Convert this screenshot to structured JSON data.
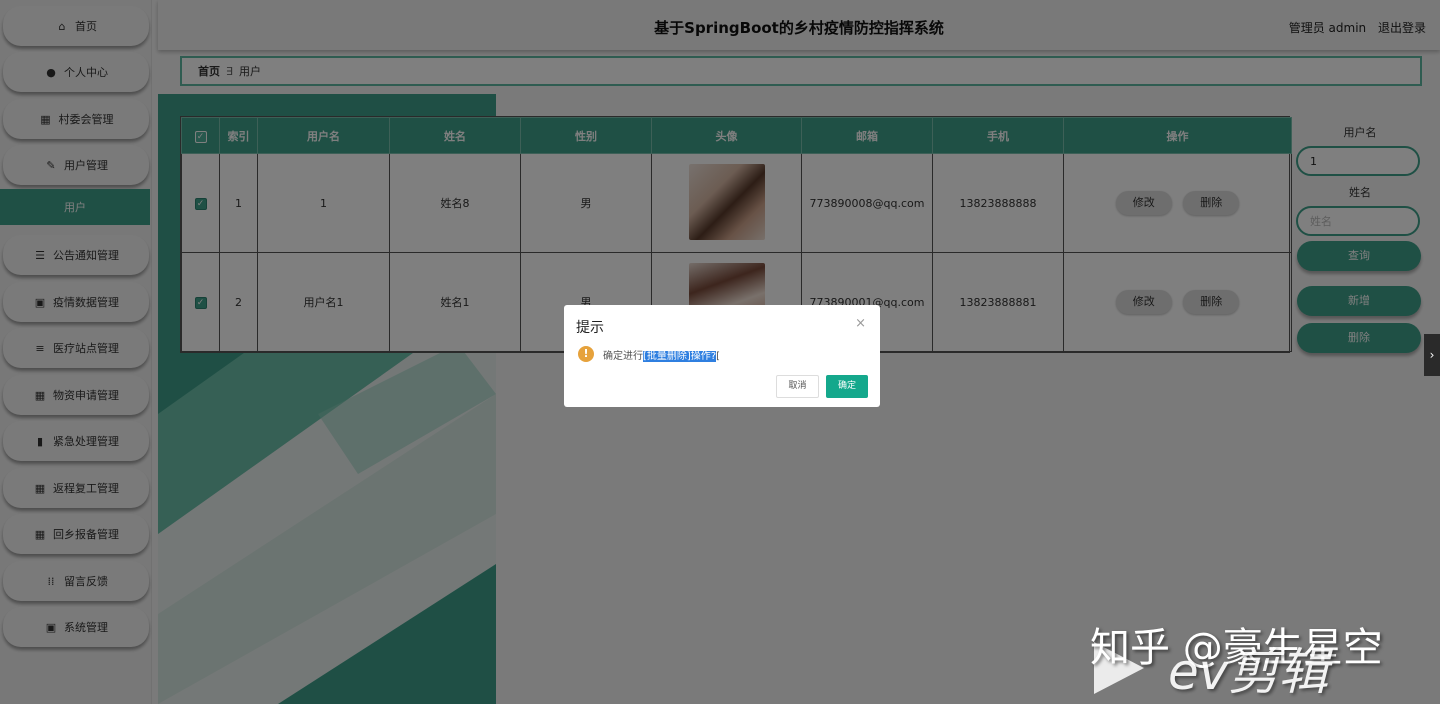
{
  "header": {
    "title": "基于SpringBoot的乡村疫情防控指挥系统",
    "user_label": "管理员 admin",
    "logout": "退出登录"
  },
  "sidebar": {
    "items": [
      {
        "label": "首页",
        "icon": "home-icon",
        "glyph": "⌂"
      },
      {
        "label": "个人中心",
        "icon": "user-icon",
        "glyph": "●"
      },
      {
        "label": "村委会管理",
        "icon": "grid-icon",
        "glyph": "▦"
      },
      {
        "label": "用户管理",
        "icon": "edit-icon",
        "glyph": "✎"
      },
      {
        "label": "用户",
        "icon": "",
        "glyph": ""
      },
      {
        "label": "公告通知管理",
        "icon": "list-icon",
        "glyph": "☰"
      },
      {
        "label": "疫情数据管理",
        "icon": "clipboard-icon",
        "glyph": "▣"
      },
      {
        "label": "医疗站点管理",
        "icon": "sliders-icon",
        "glyph": "≡"
      },
      {
        "label": "物资申请管理",
        "icon": "grid-icon",
        "glyph": "▦"
      },
      {
        "label": "紧急处理管理",
        "icon": "book-icon",
        "glyph": "▮"
      },
      {
        "label": "返程复工管理",
        "icon": "grid-icon",
        "glyph": "▦"
      },
      {
        "label": "回乡报备管理",
        "icon": "grid-icon",
        "glyph": "▦"
      },
      {
        "label": "留言反馈",
        "icon": "apps-icon",
        "glyph": "⁞⁞"
      },
      {
        "label": "系统管理",
        "icon": "clipboard-check-icon",
        "glyph": "▣"
      }
    ]
  },
  "breadcrumb": {
    "home": "首页",
    "sep": "∃",
    "current": "用户"
  },
  "table": {
    "columns": [
      "索引",
      "用户名",
      "姓名",
      "性别",
      "头像",
      "邮箱",
      "手机",
      "操作"
    ],
    "rows": [
      {
        "index": "1",
        "username": "1",
        "name": "姓名8",
        "gender": "男",
        "email": "773890008@qq.com",
        "phone": "13823888888"
      },
      {
        "index": "2",
        "username": "用户名1",
        "name": "姓名1",
        "gender": "男",
        "email": "773890001@qq.com",
        "phone": "13823888881"
      }
    ],
    "edit_label": "修改",
    "delete_label": "删除",
    "check_glyph": "✓"
  },
  "search": {
    "username_label": "用户名",
    "username_value": "1",
    "name_label": "姓名",
    "name_placeholder": "姓名",
    "query_label": "查询",
    "add_label": "新增",
    "delete_label": "删除"
  },
  "dialog": {
    "title": "提示",
    "close": "×",
    "warn_glyph": "!",
    "message_prefix": "确定进行",
    "message_selected": "[批量删除]操作?",
    "message_suffix": "[",
    "cancel": "取消",
    "confirm": "确定"
  },
  "edge_arrow": "›",
  "watermark": {
    "line1": "知乎 @豪生星空",
    "line2": "ev剪辑"
  },
  "colors": {
    "accent": "#3ea08a",
    "confirm": "#14a88c",
    "warning": "#e6a23c"
  }
}
